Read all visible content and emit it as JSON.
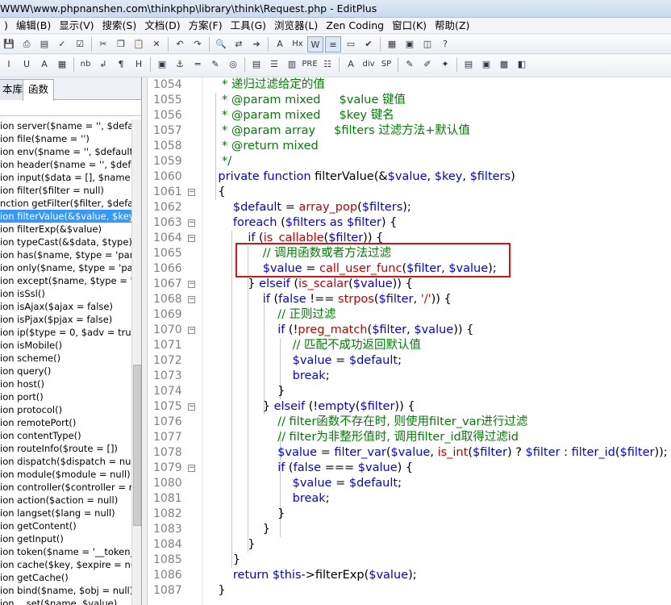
{
  "window": {
    "title": "WWW\\www.phpnanshen.com\\thinkphp\\library\\think\\Request.php - EditPlus"
  },
  "menu": [
    ")",
    "编辑(B)",
    "显示(V)",
    "搜索(S)",
    "文档(D)",
    "方案(F)",
    "工具(G)",
    "浏览器(L)",
    "Zen Coding",
    "窗口(K)",
    "帮助(Z)"
  ],
  "toolbar1": [
    "save-icon",
    "print-icon",
    "preview-icon",
    "spellcheck-icon",
    "check-icon",
    "cut-icon",
    "copy-icon",
    "paste-icon",
    "delete-icon",
    "undo-icon",
    "redo-icon",
    "find-icon",
    "replace-icon",
    "goto-icon",
    "font-icon",
    "hex-icon",
    "wordwrap-icon",
    "linenumber-icon",
    "ruler-icon",
    "ok-icon",
    "browser-icon",
    "file-icon",
    "window-icon",
    "help-icon"
  ],
  "toolbar2": [
    "italic-icon",
    "underline-icon",
    "color-icon",
    "palette-icon",
    "nb-icon",
    "newline-icon",
    "paragraph-icon",
    "heading-icon",
    "image-icon",
    "anchor-icon",
    "hr-icon",
    "pencil-icon",
    "code-icon",
    "table-icon",
    "list-icon",
    "table2-icon",
    "pre-icon",
    "list2-icon",
    "font-a-icon",
    "div-icon",
    "sp-icon",
    "edit-icon",
    "tool-icon",
    "puzzle-icon",
    "view-icon",
    "view2-icon",
    "clip-icon",
    "panel-icon"
  ],
  "toolbar_text": {
    "nb": "nb",
    "pre": "PRE",
    "div": "div",
    "sp": "SP",
    "hx": "Hx"
  },
  "left_panel": {
    "tab_lib": "本库",
    "tab_func": "函数",
    "functions": [
      "ion server($name = '', $default",
      "ion file($name = '')",
      "ion env($name = '', $default =",
      "ion header($name = '', $defau",
      "ion input($data = [], $name =",
      "ion filter($filter = null)",
      "nction getFilter($filter, $defau",
      "ion filterValue(&$value, $key,",
      "ion filterExp(&$value)",
      "ion typeCast(&$data, $type)",
      "ion has($name, $type = 'paran",
      "ion only($name, $type = 'para",
      "ion except($name, $type = 'pa",
      "ion isSsl()",
      "ion isAjax($ajax = false)",
      "ion isPjax($pjax = false)",
      "ion ip($type = 0, $adv = true)",
      "ion isMobile()",
      "ion scheme()",
      "ion query()",
      "ion host()",
      "ion port()",
      "ion protocol()",
      "ion remotePort()",
      "ion contentType()",
      "ion routeInfo($route = [])",
      "ion dispatch($dispatch = null)",
      "ion module($module = null)",
      "ion controller($controller = nu",
      "ion action($action = null)",
      "ion langset($lang = null)",
      "ion getContent()",
      "ion getInput()",
      "ion token($name = '__token__'",
      "ion cache($key, $expire = null",
      "ion getCache()",
      "ion bind($name, $obj = null)",
      "ion __set($name, $value)"
    ],
    "selected_index": 7
  },
  "editor": {
    "line_numbers": [
      "1054",
      "1055",
      "1056",
      "1057",
      "1058",
      "1059",
      "1060",
      "1061",
      "1062",
      "1063",
      "1064",
      "1065",
      "1066",
      "1067",
      "1068",
      "1069",
      "1070",
      "1071",
      "1072",
      "1073",
      "1074",
      "1075",
      "1076",
      "1077",
      "1078",
      "1079",
      "1080",
      "1081",
      "1082",
      "1083",
      "1084",
      "1085",
      "1086",
      "1087"
    ],
    "fold_lines": [
      "1061",
      "1063",
      "1064",
      "1067",
      "1068",
      "1070",
      "1075",
      "1079"
    ],
    "lines": [
      [
        [
          "c",
          "     * 递归过滤给定的值"
        ]
      ],
      [
        [
          "c",
          "     * @param mixed     $value 键值"
        ]
      ],
      [
        [
          "c",
          "     * @param mixed     $key 键名"
        ]
      ],
      [
        [
          "c",
          "     * @param array     $filters 过滤方法+默认值"
        ]
      ],
      [
        [
          "c",
          "     * @return mixed"
        ]
      ],
      [
        [
          "c",
          "     */"
        ]
      ],
      [
        [
          "k",
          "    private function "
        ],
        [
          "p",
          "filterValue(&"
        ],
        [
          "v",
          "$value"
        ],
        [
          "p",
          ", "
        ],
        [
          "v",
          "$key"
        ],
        [
          "p",
          ", "
        ],
        [
          "v",
          "$filters"
        ],
        [
          "p",
          ")"
        ]
      ],
      [
        [
          "p",
          "    {"
        ]
      ],
      [
        [
          "p",
          "        "
        ],
        [
          "v",
          "$default"
        ],
        [
          "p",
          " = "
        ],
        [
          "f",
          "array_pop"
        ],
        [
          "p",
          "("
        ],
        [
          "v",
          "$filters"
        ],
        [
          "p",
          ");"
        ]
      ],
      [
        [
          "p",
          "        "
        ],
        [
          "k",
          "foreach"
        ],
        [
          "p",
          " ("
        ],
        [
          "v",
          "$filters"
        ],
        [
          "k",
          " as "
        ],
        [
          "v",
          "$filter"
        ],
        [
          "p",
          ") {"
        ]
      ],
      [
        [
          "p",
          "            "
        ],
        [
          "k",
          "if"
        ],
        [
          "p",
          " ("
        ],
        [
          "f",
          "is_callable"
        ],
        [
          "p",
          "("
        ],
        [
          "v",
          "$filter"
        ],
        [
          "p",
          ")) {"
        ]
      ],
      [
        [
          "c",
          "                // 调用函数或者方法过滤"
        ]
      ],
      [
        [
          "p",
          "                "
        ],
        [
          "v",
          "$value"
        ],
        [
          "p",
          " = "
        ],
        [
          "f",
          "call_user_func"
        ],
        [
          "p",
          "("
        ],
        [
          "v",
          "$filter"
        ],
        [
          "p",
          ", "
        ],
        [
          "v",
          "$value"
        ],
        [
          "p",
          ");"
        ]
      ],
      [
        [
          "p",
          "            } "
        ],
        [
          "k",
          "elseif"
        ],
        [
          "p",
          " ("
        ],
        [
          "f",
          "is_scalar"
        ],
        [
          "p",
          "("
        ],
        [
          "v",
          "$value"
        ],
        [
          "p",
          ")) {"
        ]
      ],
      [
        [
          "p",
          "                "
        ],
        [
          "k",
          "if"
        ],
        [
          "p",
          " ("
        ],
        [
          "k",
          "false"
        ],
        [
          "p",
          " !== "
        ],
        [
          "f",
          "strpos"
        ],
        [
          "p",
          "("
        ],
        [
          "v",
          "$filter"
        ],
        [
          "p",
          ", "
        ],
        [
          "s",
          "'/'"
        ],
        [
          "p",
          ")) {"
        ]
      ],
      [
        [
          "c",
          "                    // 正则过滤"
        ]
      ],
      [
        [
          "p",
          "                    "
        ],
        [
          "k",
          "if"
        ],
        [
          "p",
          " (!"
        ],
        [
          "f",
          "preg_match"
        ],
        [
          "p",
          "("
        ],
        [
          "v",
          "$filter"
        ],
        [
          "p",
          ", "
        ],
        [
          "v",
          "$value"
        ],
        [
          "p",
          ")) {"
        ]
      ],
      [
        [
          "c",
          "                        // 匹配不成功返回默认值"
        ]
      ],
      [
        [
          "p",
          "                        "
        ],
        [
          "v",
          "$value"
        ],
        [
          "p",
          " = "
        ],
        [
          "v",
          "$default"
        ],
        [
          "p",
          ";"
        ]
      ],
      [
        [
          "p",
          "                        "
        ],
        [
          "k",
          "break"
        ],
        [
          "p",
          ";"
        ]
      ],
      [
        [
          "p",
          "                    }"
        ]
      ],
      [
        [
          "p",
          "                } "
        ],
        [
          "k",
          "elseif"
        ],
        [
          "p",
          " (!"
        ],
        [
          "k",
          "empty"
        ],
        [
          "p",
          "("
        ],
        [
          "v",
          "$filter"
        ],
        [
          "p",
          ")) {"
        ]
      ],
      [
        [
          "c",
          "                    // filter函数不存在时, 则使用filter_var进行过滤"
        ]
      ],
      [
        [
          "c",
          "                    // filter为非整形值时, 调用filter_id取得过滤id"
        ]
      ],
      [
        [
          "p",
          "                    "
        ],
        [
          "v",
          "$value"
        ],
        [
          "p",
          " = "
        ],
        [
          "k",
          "filter_var"
        ],
        [
          "p",
          "("
        ],
        [
          "v",
          "$value"
        ],
        [
          "p",
          ", "
        ],
        [
          "f",
          "is_int"
        ],
        [
          "p",
          "("
        ],
        [
          "v",
          "$filter"
        ],
        [
          "p",
          ") ? "
        ],
        [
          "v",
          "$filter"
        ],
        [
          "p",
          " : "
        ],
        [
          "k",
          "filter_id"
        ],
        [
          "p",
          "("
        ],
        [
          "v",
          "$filter"
        ],
        [
          "p",
          "));"
        ]
      ],
      [
        [
          "p",
          "                    "
        ],
        [
          "k",
          "if"
        ],
        [
          "p",
          " ("
        ],
        [
          "k",
          "false"
        ],
        [
          "p",
          " === "
        ],
        [
          "v",
          "$value"
        ],
        [
          "p",
          ") {"
        ]
      ],
      [
        [
          "p",
          "                        "
        ],
        [
          "v",
          "$value"
        ],
        [
          "p",
          " = "
        ],
        [
          "v",
          "$default"
        ],
        [
          "p",
          ";"
        ]
      ],
      [
        [
          "p",
          "                        "
        ],
        [
          "k",
          "break"
        ],
        [
          "p",
          ";"
        ]
      ],
      [
        [
          "p",
          "                    }"
        ]
      ],
      [
        [
          "p",
          "                }"
        ]
      ],
      [
        [
          "p",
          "            }"
        ]
      ],
      [
        [
          "p",
          "        }"
        ]
      ],
      [
        [
          "p",
          "        "
        ],
        [
          "k",
          "return"
        ],
        [
          "p",
          " "
        ],
        [
          "v",
          "$this"
        ],
        [
          "p",
          "->filterExp("
        ],
        [
          "v",
          "$value"
        ],
        [
          "p",
          ");"
        ]
      ],
      [
        [
          "p",
          "    }"
        ]
      ]
    ]
  },
  "colors": {
    "comment": "#008000",
    "keyword": "#0000ff",
    "function": "#c80000",
    "string": "#d40000",
    "highlight_box": "#e01010",
    "selection": "#3399ff"
  }
}
